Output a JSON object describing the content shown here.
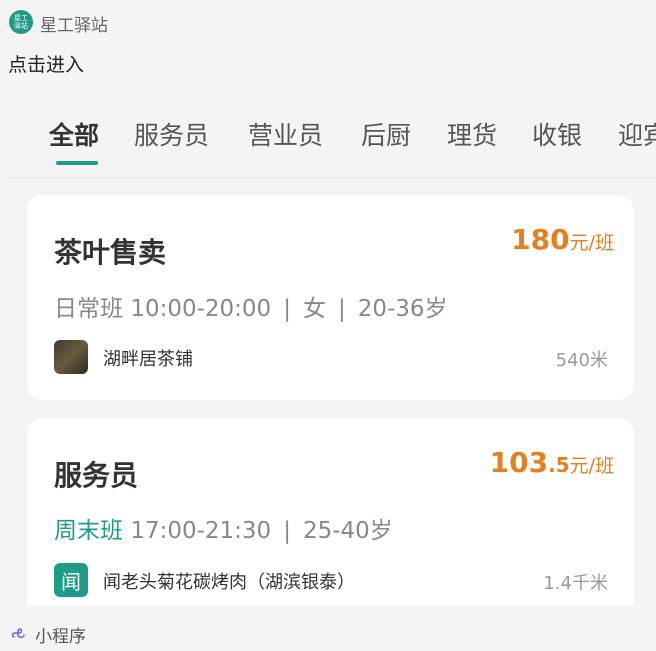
{
  "header": {
    "logo_text": [
      "星工",
      "驿站"
    ],
    "app_name": "星工驿站",
    "brand_color": "#1e9c88"
  },
  "enter_link": "点击进入",
  "tabs": [
    {
      "label": "全部",
      "active": true
    },
    {
      "label": "服务员",
      "active": false
    },
    {
      "label": "营业员",
      "active": false
    },
    {
      "label": "后厨",
      "active": false
    },
    {
      "label": "理货",
      "active": false
    },
    {
      "label": "收银",
      "active": false
    },
    {
      "label": "迎宾",
      "active": false
    }
  ],
  "jobs": [
    {
      "title": "茶叶售卖",
      "salary_int": "180",
      "salary_dec": "",
      "salary_unit": "元/班",
      "shift_type": "日常班",
      "shift_time": "10:00-20:00",
      "gender": "女",
      "age": "20-36岁",
      "shop_name": "湖畔居茶铺",
      "shop_avatar": "shop-photo",
      "distance": "540米"
    },
    {
      "title": "服务员",
      "salary_int": "103",
      "salary_dec": ".5",
      "salary_unit": "元/班",
      "shift_type": "周末班",
      "shift_time": "17:00-21:30",
      "age": "25-40岁",
      "shop_name": "闻老头菊花碳烤肉（湖滨银泰）",
      "shop_avatar_text": "闻",
      "distance": "1.4千米"
    }
  ],
  "footer": {
    "icon": "mini-program-icon",
    "label": "小程序"
  },
  "colors": {
    "salary": "#e4801f",
    "accent": "#1e9c88"
  }
}
